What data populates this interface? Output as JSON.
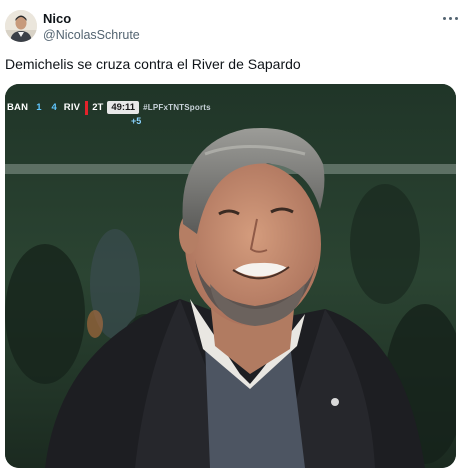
{
  "author": {
    "name": "Nico",
    "handle": "@NicolasSchrute"
  },
  "post": {
    "text": "Demichelis se cruza contra el River de Sapardo"
  },
  "media": {
    "scoreboard": {
      "home_team": "BAN",
      "home_score": "1",
      "away_score": "4",
      "away_team": "RIV",
      "half": "2T",
      "clock": "49:11",
      "tag": "#LPFxTNTSports",
      "added_time": "+5"
    }
  },
  "icons": {
    "more": "more-horizontal-icon"
  },
  "colors": {
    "text_primary": "#0f1419",
    "text_secondary": "#536471",
    "score_accent": "#61c7ff",
    "scorebug_red": "#e3232b"
  }
}
